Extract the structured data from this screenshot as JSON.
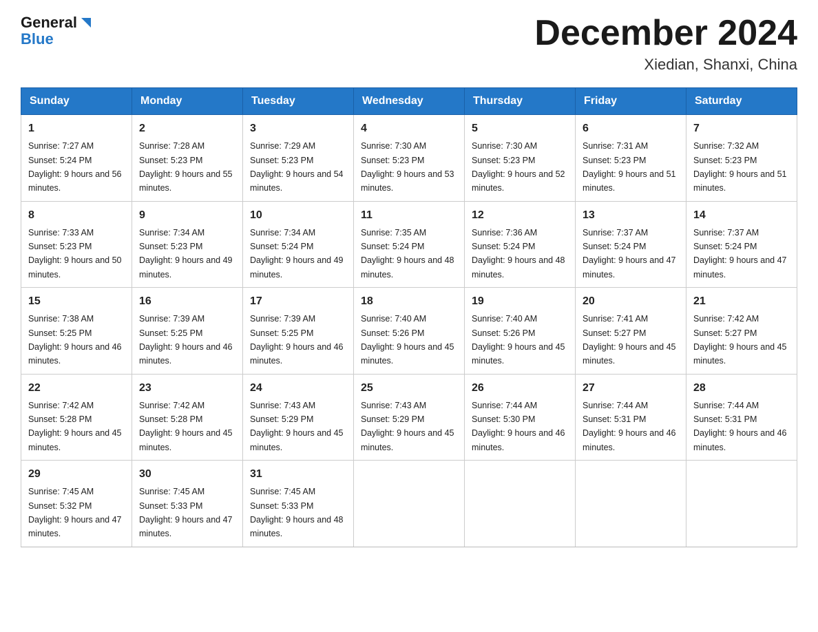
{
  "header": {
    "logo_general": "General",
    "logo_blue": "Blue",
    "month_title": "December 2024",
    "location": "Xiedian, Shanxi, China"
  },
  "weekdays": [
    "Sunday",
    "Monday",
    "Tuesday",
    "Wednesday",
    "Thursday",
    "Friday",
    "Saturday"
  ],
  "weeks": [
    [
      {
        "day": "1",
        "sunrise": "7:27 AM",
        "sunset": "5:24 PM",
        "daylight": "9 hours and 56 minutes."
      },
      {
        "day": "2",
        "sunrise": "7:28 AM",
        "sunset": "5:23 PM",
        "daylight": "9 hours and 55 minutes."
      },
      {
        "day": "3",
        "sunrise": "7:29 AM",
        "sunset": "5:23 PM",
        "daylight": "9 hours and 54 minutes."
      },
      {
        "day": "4",
        "sunrise": "7:30 AM",
        "sunset": "5:23 PM",
        "daylight": "9 hours and 53 minutes."
      },
      {
        "day": "5",
        "sunrise": "7:30 AM",
        "sunset": "5:23 PM",
        "daylight": "9 hours and 52 minutes."
      },
      {
        "day": "6",
        "sunrise": "7:31 AM",
        "sunset": "5:23 PM",
        "daylight": "9 hours and 51 minutes."
      },
      {
        "day": "7",
        "sunrise": "7:32 AM",
        "sunset": "5:23 PM",
        "daylight": "9 hours and 51 minutes."
      }
    ],
    [
      {
        "day": "8",
        "sunrise": "7:33 AM",
        "sunset": "5:23 PM",
        "daylight": "9 hours and 50 minutes."
      },
      {
        "day": "9",
        "sunrise": "7:34 AM",
        "sunset": "5:23 PM",
        "daylight": "9 hours and 49 minutes."
      },
      {
        "day": "10",
        "sunrise": "7:34 AM",
        "sunset": "5:24 PM",
        "daylight": "9 hours and 49 minutes."
      },
      {
        "day": "11",
        "sunrise": "7:35 AM",
        "sunset": "5:24 PM",
        "daylight": "9 hours and 48 minutes."
      },
      {
        "day": "12",
        "sunrise": "7:36 AM",
        "sunset": "5:24 PM",
        "daylight": "9 hours and 48 minutes."
      },
      {
        "day": "13",
        "sunrise": "7:37 AM",
        "sunset": "5:24 PM",
        "daylight": "9 hours and 47 minutes."
      },
      {
        "day": "14",
        "sunrise": "7:37 AM",
        "sunset": "5:24 PM",
        "daylight": "9 hours and 47 minutes."
      }
    ],
    [
      {
        "day": "15",
        "sunrise": "7:38 AM",
        "sunset": "5:25 PM",
        "daylight": "9 hours and 46 minutes."
      },
      {
        "day": "16",
        "sunrise": "7:39 AM",
        "sunset": "5:25 PM",
        "daylight": "9 hours and 46 minutes."
      },
      {
        "day": "17",
        "sunrise": "7:39 AM",
        "sunset": "5:25 PM",
        "daylight": "9 hours and 46 minutes."
      },
      {
        "day": "18",
        "sunrise": "7:40 AM",
        "sunset": "5:26 PM",
        "daylight": "9 hours and 45 minutes."
      },
      {
        "day": "19",
        "sunrise": "7:40 AM",
        "sunset": "5:26 PM",
        "daylight": "9 hours and 45 minutes."
      },
      {
        "day": "20",
        "sunrise": "7:41 AM",
        "sunset": "5:27 PM",
        "daylight": "9 hours and 45 minutes."
      },
      {
        "day": "21",
        "sunrise": "7:42 AM",
        "sunset": "5:27 PM",
        "daylight": "9 hours and 45 minutes."
      }
    ],
    [
      {
        "day": "22",
        "sunrise": "7:42 AM",
        "sunset": "5:28 PM",
        "daylight": "9 hours and 45 minutes."
      },
      {
        "day": "23",
        "sunrise": "7:42 AM",
        "sunset": "5:28 PM",
        "daylight": "9 hours and 45 minutes."
      },
      {
        "day": "24",
        "sunrise": "7:43 AM",
        "sunset": "5:29 PM",
        "daylight": "9 hours and 45 minutes."
      },
      {
        "day": "25",
        "sunrise": "7:43 AM",
        "sunset": "5:29 PM",
        "daylight": "9 hours and 45 minutes."
      },
      {
        "day": "26",
        "sunrise": "7:44 AM",
        "sunset": "5:30 PM",
        "daylight": "9 hours and 46 minutes."
      },
      {
        "day": "27",
        "sunrise": "7:44 AM",
        "sunset": "5:31 PM",
        "daylight": "9 hours and 46 minutes."
      },
      {
        "day": "28",
        "sunrise": "7:44 AM",
        "sunset": "5:31 PM",
        "daylight": "9 hours and 46 minutes."
      }
    ],
    [
      {
        "day": "29",
        "sunrise": "7:45 AM",
        "sunset": "5:32 PM",
        "daylight": "9 hours and 47 minutes."
      },
      {
        "day": "30",
        "sunrise": "7:45 AM",
        "sunset": "5:33 PM",
        "daylight": "9 hours and 47 minutes."
      },
      {
        "day": "31",
        "sunrise": "7:45 AM",
        "sunset": "5:33 PM",
        "daylight": "9 hours and 48 minutes."
      },
      null,
      null,
      null,
      null
    ]
  ]
}
